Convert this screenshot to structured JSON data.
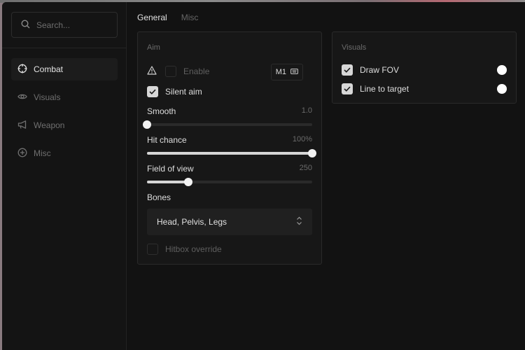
{
  "search": {
    "placeholder": "Search..."
  },
  "sidebar": {
    "items": [
      {
        "label": "Combat",
        "icon": "crosshair-icon",
        "active": true
      },
      {
        "label": "Visuals",
        "icon": "eye-icon",
        "active": false
      },
      {
        "label": "Weapon",
        "icon": "megaphone-icon",
        "active": false
      },
      {
        "label": "Misc",
        "icon": "plus-circle-icon",
        "active": false
      }
    ]
  },
  "tabs": [
    {
      "label": "General",
      "active": true
    },
    {
      "label": "Misc",
      "active": false
    }
  ],
  "aim": {
    "title": "Aim",
    "enable": {
      "label": "Enable",
      "checked": false,
      "keybind": "M1",
      "warning_icon": "warning-icon",
      "keybind_icon": "keyboard-icon"
    },
    "silent_aim": {
      "label": "Silent aim",
      "checked": true
    },
    "smooth": {
      "label": "Smooth",
      "value": "1.0",
      "fraction": 0.0
    },
    "hit_chance": {
      "label": "Hit chance",
      "value": "100%",
      "fraction": 1.0
    },
    "fov": {
      "label": "Field of view",
      "value": "250",
      "fraction": 0.25
    },
    "bones": {
      "label": "Bones",
      "selected": "Head, Pelvis, Legs"
    },
    "hitbox_override": {
      "label": "Hitbox override",
      "checked": false
    }
  },
  "visuals": {
    "title": "Visuals",
    "draw_fov": {
      "label": "Draw FOV",
      "checked": true,
      "color": "#ffffff"
    },
    "line_to_target": {
      "label": "Line to target",
      "checked": true,
      "color": "#ffffff"
    }
  },
  "colors": {
    "accent": "#d7d7d7",
    "background": "#121212",
    "panel": "#171717"
  }
}
